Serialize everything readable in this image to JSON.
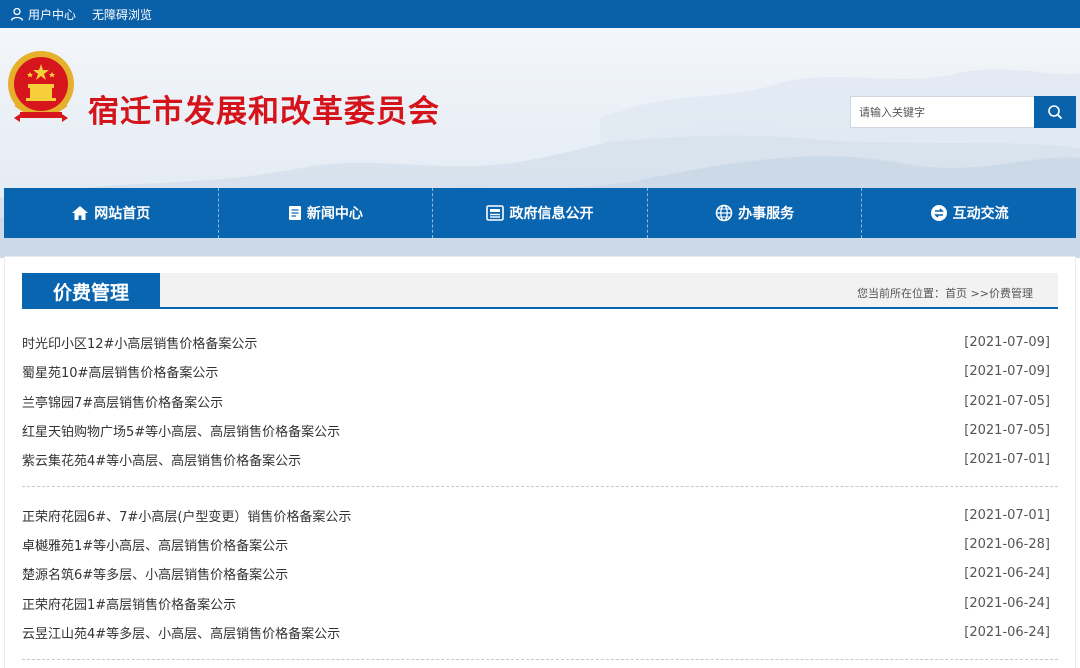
{
  "topbar": {
    "user_center": "用户中心",
    "accessibility": "无障碍浏览"
  },
  "header": {
    "site_title": "宿迁市发展和改革委员会",
    "search_placeholder": "请输入关键字"
  },
  "nav": {
    "items": [
      {
        "label": "网站首页",
        "icon": "home-icon"
      },
      {
        "label": "新闻中心",
        "icon": "document-icon"
      },
      {
        "label": "政府信息公开",
        "icon": "newspaper-icon"
      },
      {
        "label": "办事服务",
        "icon": "globe-icon"
      },
      {
        "label": "互动交流",
        "icon": "exchange-icon"
      }
    ]
  },
  "section": {
    "title": "价费管理",
    "breadcrumb_prefix": "您当前所在位置：",
    "breadcrumb_home": "首页",
    "breadcrumb_sep": " >>",
    "breadcrumb_current": "价费管理"
  },
  "news": [
    {
      "title": "时光印小区12#小高层销售价格备案公示",
      "date": "[2021-07-09]"
    },
    {
      "title": "蜀星苑10#高层销售价格备案公示",
      "date": "[2021-07-09]"
    },
    {
      "title": "兰亭锦园7#高层销售价格备案公示",
      "date": "[2021-07-05]"
    },
    {
      "title": "红星天铂购物广场5#等小高层、高层销售价格备案公示",
      "date": "[2021-07-05]"
    },
    {
      "title": "紫云集花苑4#等小高层、高层销售价格备案公示",
      "date": "[2021-07-01]"
    },
    {
      "title": "正荣府花园6#、7#小高层(户型变更）销售价格备案公示",
      "date": "[2021-07-01]"
    },
    {
      "title": "卓樾雅苑1#等小高层、高层销售价格备案公示",
      "date": "[2021-06-28]"
    },
    {
      "title": "楚源名筑6#等多层、小高层销售价格备案公示",
      "date": "[2021-06-24]"
    },
    {
      "title": "正荣府花园1#高层销售价格备案公示",
      "date": "[2021-06-24]"
    },
    {
      "title": "云昱江山苑4#等多层、小高层、高层销售价格备案公示",
      "date": "[2021-06-24]"
    }
  ],
  "colors": {
    "brand_blue": "#0a65b0",
    "title_red": "#d4141a"
  }
}
